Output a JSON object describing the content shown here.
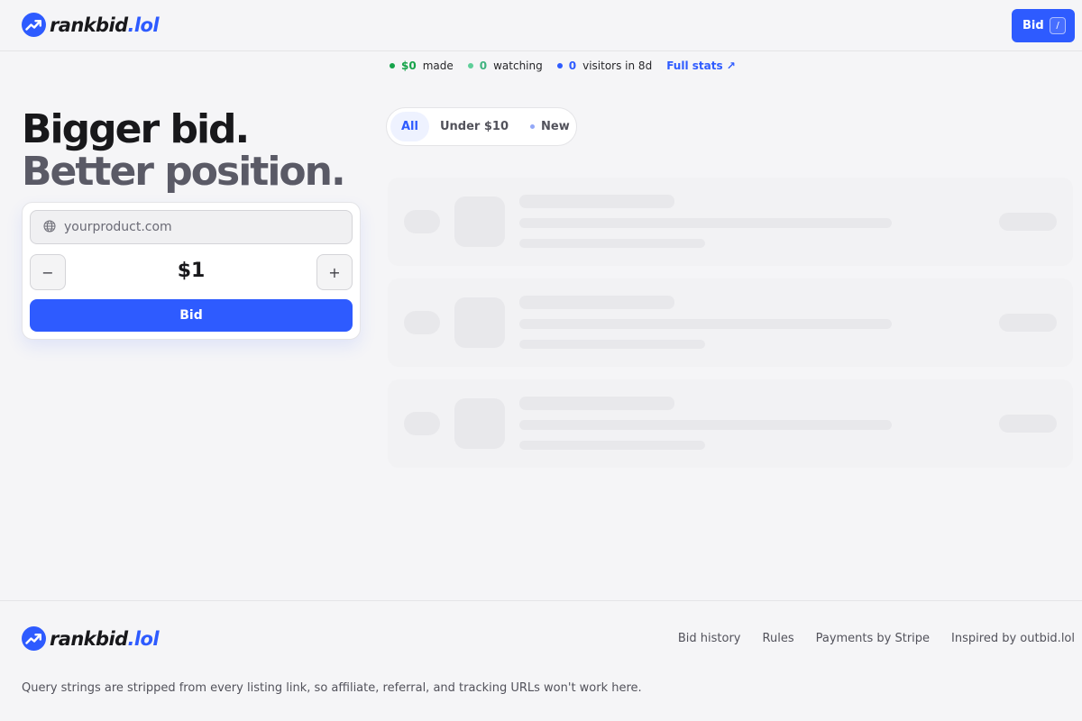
{
  "brand": {
    "name": "rankbid",
    "tld": ".lol"
  },
  "header": {
    "bid_label": "Bid",
    "shortcut": "/"
  },
  "stats": {
    "made_value": "$0",
    "made_label": "made",
    "watching_value": "0",
    "watching_label": "watching",
    "visitors_value": "0",
    "visitors_label": "visitors in 8d",
    "full_stats_label": "Full stats ↗"
  },
  "hero": {
    "line1": "Bigger bid.",
    "line2": "Better position."
  },
  "bid_form": {
    "url_placeholder": "yourproduct.com",
    "url_value": "",
    "minus_label": "−",
    "plus_label": "+",
    "amount": "$1",
    "submit_label": "Bid"
  },
  "filters": [
    {
      "label": "All",
      "active": true
    },
    {
      "label": "Under $10",
      "active": false
    },
    {
      "label": "New",
      "active": false
    }
  ],
  "footer": {
    "links": [
      "Bid history",
      "Rules",
      "Payments by Stripe",
      "Inspired by outbid.lol"
    ],
    "disclaimer": "Query strings are stripped from every listing link, so affiliate, referral, and tracking URLs won't work here."
  },
  "colors": {
    "accent": "#2e5bff",
    "made_dot": "#16a34a",
    "watching_dot": "#5fcf99",
    "visitors_dot": "#2e5bff",
    "background": "#f5f5f7"
  },
  "icons": {
    "logo": "trend-up-icon",
    "url_field": "globe-icon"
  }
}
